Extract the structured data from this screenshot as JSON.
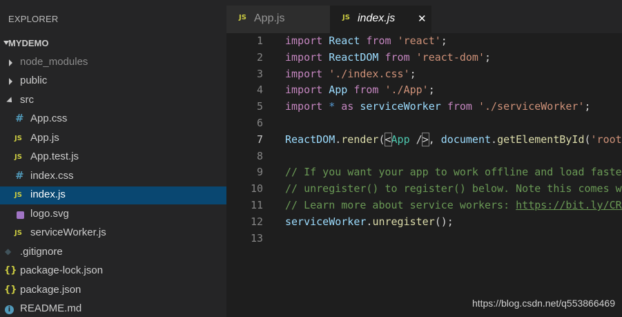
{
  "sidebar": {
    "title": "EXPLORER",
    "section": "MYDEMO",
    "items": [
      {
        "label": "node_modules",
        "kind": "folder",
        "icon": "chevron-right-icon"
      },
      {
        "label": "public",
        "kind": "folder",
        "icon": "chevron-right-icon"
      },
      {
        "label": "src",
        "kind": "folder-open",
        "icon": "chevron-down-icon"
      },
      {
        "label": "App.css",
        "icon": "css-file-icon",
        "glyph": "#"
      },
      {
        "label": "App.js",
        "icon": "js-file-icon",
        "glyph": "JS"
      },
      {
        "label": "App.test.js",
        "icon": "js-file-icon",
        "glyph": "JS"
      },
      {
        "label": "index.css",
        "icon": "css-file-icon",
        "glyph": "#"
      },
      {
        "label": "index.js",
        "icon": "js-file-icon",
        "glyph": "JS",
        "selected": true
      },
      {
        "label": "logo.svg",
        "icon": "svg-file-icon"
      },
      {
        "label": "serviceWorker.js",
        "icon": "js-file-icon",
        "glyph": "JS"
      },
      {
        "label": ".gitignore",
        "icon": "git-file-icon",
        "glyph": "◆"
      },
      {
        "label": "package-lock.json",
        "icon": "json-file-icon",
        "glyph": "{}"
      },
      {
        "label": "package.json",
        "icon": "json-file-icon",
        "glyph": "{}"
      },
      {
        "label": "README.md",
        "icon": "info-file-icon",
        "glyph": "i"
      }
    ]
  },
  "tabs": [
    {
      "label": "App.js",
      "icon_glyph": "JS",
      "active": false
    },
    {
      "label": "index.js",
      "icon_glyph": "JS",
      "active": true,
      "close_glyph": "✕"
    }
  ],
  "editor": {
    "active_line": 7,
    "lines": [
      {
        "num": "1",
        "tokens": [
          [
            "kw",
            "import"
          ],
          [
            "plain",
            " "
          ],
          [
            "var",
            "React"
          ],
          [
            "plain",
            " "
          ],
          [
            "kw",
            "from"
          ],
          [
            "plain",
            " "
          ],
          [
            "str",
            "'react'"
          ],
          [
            "plain",
            ";"
          ]
        ]
      },
      {
        "num": "2",
        "tokens": [
          [
            "kw",
            "import"
          ],
          [
            "plain",
            " "
          ],
          [
            "var",
            "ReactDOM"
          ],
          [
            "plain",
            " "
          ],
          [
            "kw",
            "from"
          ],
          [
            "plain",
            " "
          ],
          [
            "str",
            "'react-dom'"
          ],
          [
            "plain",
            ";"
          ]
        ]
      },
      {
        "num": "3",
        "tokens": [
          [
            "kw",
            "import"
          ],
          [
            "plain",
            " "
          ],
          [
            "str",
            "'./index.css'"
          ],
          [
            "plain",
            ";"
          ]
        ]
      },
      {
        "num": "4",
        "tokens": [
          [
            "kw",
            "import"
          ],
          [
            "plain",
            " "
          ],
          [
            "var",
            "App"
          ],
          [
            "plain",
            " "
          ],
          [
            "kw",
            "from"
          ],
          [
            "plain",
            " "
          ],
          [
            "str",
            "'./App'"
          ],
          [
            "plain",
            ";"
          ]
        ]
      },
      {
        "num": "5",
        "tokens": [
          [
            "kw",
            "import"
          ],
          [
            "plain",
            " "
          ],
          [
            "op",
            "*"
          ],
          [
            "plain",
            " "
          ],
          [
            "kw",
            "as"
          ],
          [
            "plain",
            " "
          ],
          [
            "var",
            "serviceWorker"
          ],
          [
            "plain",
            " "
          ],
          [
            "kw",
            "from"
          ],
          [
            "plain",
            " "
          ],
          [
            "str",
            "'./serviceWorker'"
          ],
          [
            "plain",
            ";"
          ]
        ]
      },
      {
        "num": "6",
        "tokens": []
      },
      {
        "num": "7",
        "tokens": [
          [
            "var",
            "ReactDOM"
          ],
          [
            "plain",
            "."
          ],
          [
            "fn",
            "render"
          ],
          [
            "plain",
            "("
          ],
          [
            "bracket",
            "<"
          ],
          [
            "tag",
            "App"
          ],
          [
            "plain",
            " /"
          ],
          [
            "bracket",
            ">"
          ],
          [
            "plain",
            ", "
          ],
          [
            "var",
            "document"
          ],
          [
            "plain",
            "."
          ],
          [
            "fn",
            "getElementById"
          ],
          [
            "plain",
            "("
          ],
          [
            "str",
            "'root'"
          ],
          [
            "plain",
            "));"
          ]
        ]
      },
      {
        "num": "8",
        "tokens": []
      },
      {
        "num": "9",
        "tokens": [
          [
            "cm",
            "// If you want your app to work offline and load faster, you can change"
          ]
        ]
      },
      {
        "num": "10",
        "tokens": [
          [
            "cm",
            "// unregister() to register() below. Note this comes with some pitfalls."
          ]
        ]
      },
      {
        "num": "11",
        "tokens": [
          [
            "cm",
            "// Learn more about service workers: "
          ],
          [
            "link",
            "https://bit.ly/CRA-PWA"
          ]
        ]
      },
      {
        "num": "12",
        "tokens": [
          [
            "var",
            "serviceWorker"
          ],
          [
            "plain",
            "."
          ],
          [
            "fn",
            "unregister"
          ],
          [
            "plain",
            "();"
          ]
        ]
      },
      {
        "num": "13",
        "tokens": []
      }
    ]
  },
  "watermark": "https://blog.csdn.net/q553866469"
}
